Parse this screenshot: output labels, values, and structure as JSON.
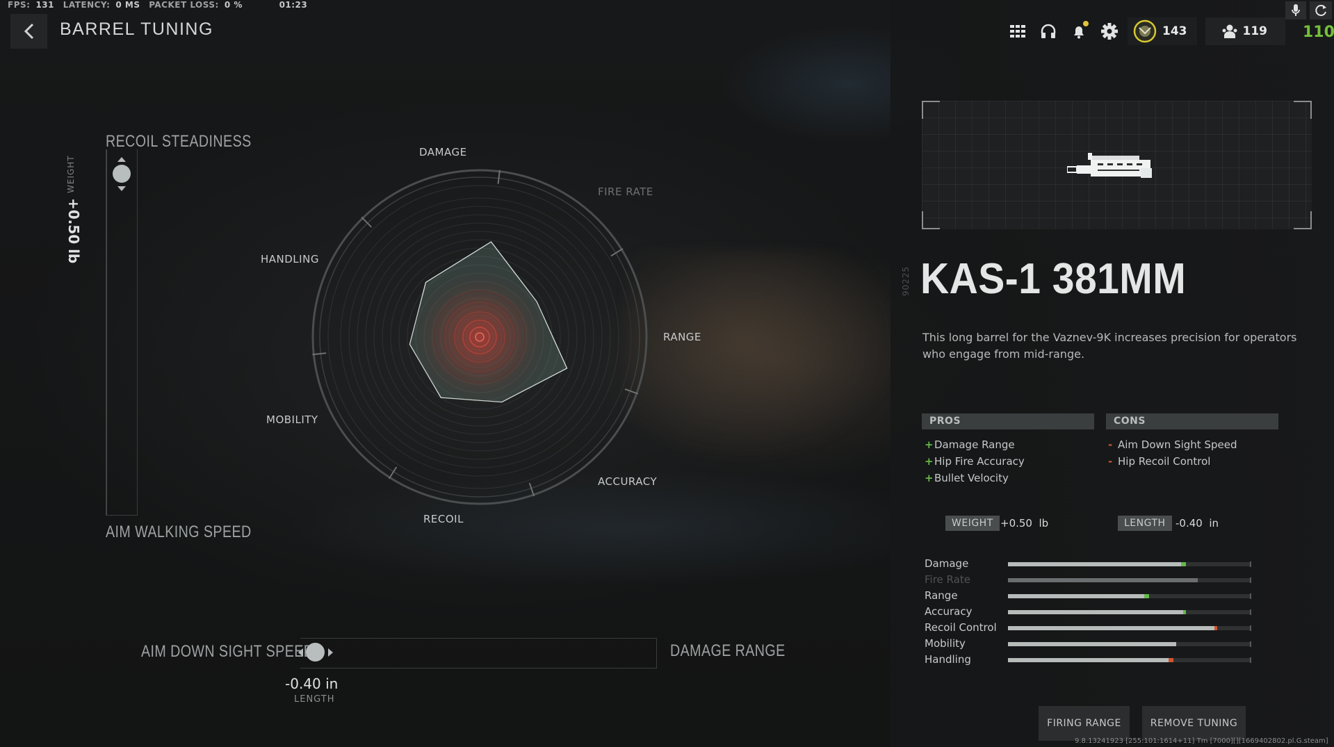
{
  "perf": {
    "fps_label": "FPS:",
    "fps": "131",
    "latency_label": "LATENCY:",
    "latency": "0 MS",
    "packet_label": "PACKET LOSS:",
    "packet": "0 %",
    "time": "01:23"
  },
  "header": {
    "title": "BARREL TUNING",
    "level": "143",
    "friends": "119",
    "green_value": "110"
  },
  "vertical_tuning": {
    "axis_label": "WEIGHT",
    "value": "+0.50 lb",
    "top_label": "RECOIL STEADINESS",
    "bottom_label": "AIM WALKING SPEED",
    "position": 0.0
  },
  "horizontal_tuning": {
    "left_label": "AIM DOWN SIGHT SPEED",
    "right_label": "DAMAGE RANGE",
    "value": "-0.40 in",
    "unit_label": "LENGTH",
    "position": 0.0
  },
  "radar": {
    "labels": {
      "damage": "DAMAGE",
      "fire_rate": "FIRE RATE",
      "range": "RANGE",
      "accuracy": "ACCURACY",
      "recoil": "RECOIL",
      "mobility": "MOBILITY",
      "handling": "HANDLING"
    },
    "values": [
      0.6,
      0.42,
      0.58,
      0.43,
      0.45,
      0.44,
      0.48
    ],
    "accent_color": "#c43b32",
    "polygon_color": "#8fb7a4"
  },
  "attachment": {
    "code": "90225",
    "name": "KAS-1 381MM",
    "description": "This long barrel for the Vaznev-9K increases precision for operators who engage from mid-range.",
    "pros_label": "PROS",
    "cons_label": "CONS",
    "pros": [
      "Damage Range",
      "Hip Fire Accuracy",
      "Bullet Velocity"
    ],
    "cons": [
      "Aim Down Sight Speed",
      "Hip Recoil Control"
    ],
    "weight_label": "WEIGHT",
    "weight_value": "+0.50  lb",
    "length_label": "LENGTH",
    "length_value": "-0.40  in"
  },
  "stats": [
    {
      "name": "Damage",
      "base": 0.71,
      "change": 0.02,
      "dir": "up"
    },
    {
      "name": "Fire Rate",
      "base": 0.78,
      "change": 0,
      "dir": "none",
      "dim": true
    },
    {
      "name": "Range",
      "base": 0.56,
      "change": 0.02,
      "dir": "up"
    },
    {
      "name": "Accuracy",
      "base": 0.72,
      "change": 0.01,
      "dir": "up"
    },
    {
      "name": "Recoil Control",
      "base": 0.86,
      "change": 0.01,
      "dir": "down"
    },
    {
      "name": "Mobility",
      "base": 0.69,
      "change": 0.0,
      "dir": "none"
    },
    {
      "name": "Handling",
      "base": 0.68,
      "change": 0.02,
      "dir": "down"
    }
  ],
  "buttons": {
    "firing_range": "FIRING RANGE",
    "remove_tuning": "REMOVE TUNING"
  },
  "footer": {
    "build": "9.8.13241923 [255:101:1614+11] Tm [7000][][1669402802.pl.G.steam]"
  },
  "colors": {
    "positive": "#65b84a",
    "negative": "#d1552e",
    "green_value": "#74c03a"
  }
}
